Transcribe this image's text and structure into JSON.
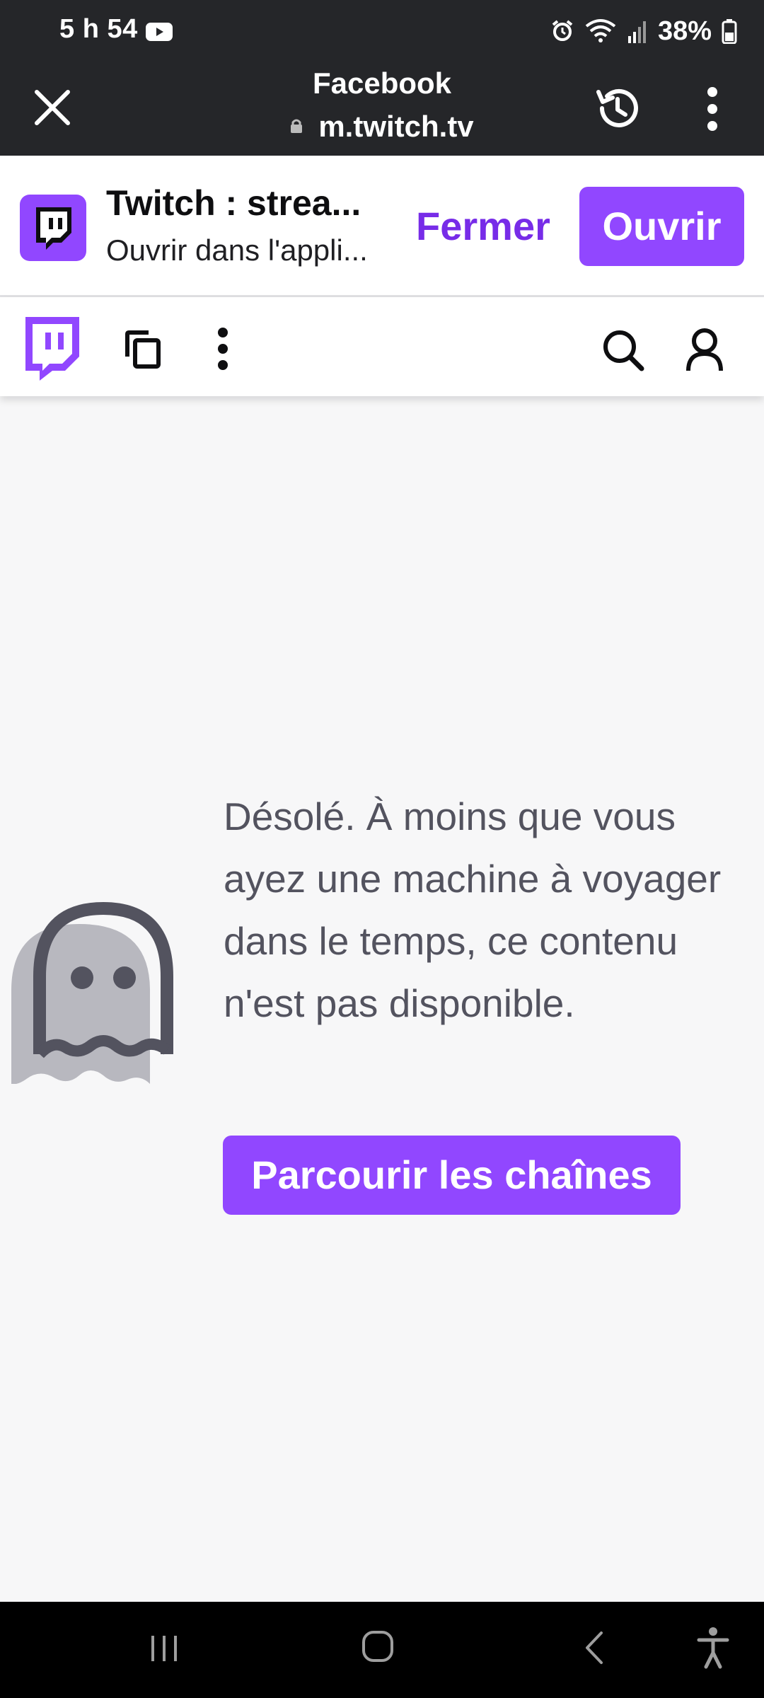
{
  "status_bar": {
    "time": "5 h 54",
    "battery": "38%",
    "icons": [
      "youtube-icon",
      "alarm-icon",
      "wifi-icon",
      "signal-icon",
      "battery-icon"
    ]
  },
  "browser": {
    "title": "Facebook",
    "url": "m.twitch.tv",
    "icons": [
      "close-icon",
      "lock-icon",
      "history-icon",
      "more-vertical-icon"
    ]
  },
  "app_banner": {
    "app_name": "Twitch : strea...",
    "subtitle": "Ouvrir dans l'appli...",
    "close_label": "Fermer",
    "open_label": "Ouvrir"
  },
  "twitch_nav": {
    "icons": [
      "twitch-logo-icon",
      "copy-icon",
      "more-vertical-icon",
      "search-icon",
      "user-icon"
    ]
  },
  "content": {
    "message": "Désolé. À moins que vous ayez une machine à voyager dans le temps, ce contenu n'est pas disponible.",
    "button_label": "Parcourir les chaînes",
    "illustration": "ghost-icon"
  },
  "android_nav": {
    "icons": [
      "recents-icon",
      "home-icon",
      "back-icon",
      "accessibility-icon"
    ]
  },
  "colors": {
    "brand": "#9147ff",
    "brand_dark_text": "#772ce8",
    "top_bar": "#252629",
    "page_bg": "#f7f7f8"
  }
}
